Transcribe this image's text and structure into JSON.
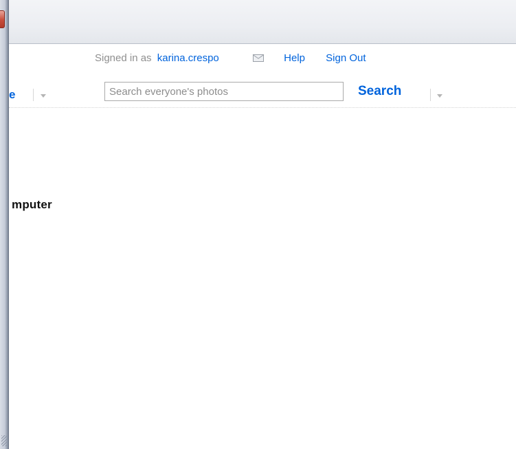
{
  "userbar": {
    "signed_in_label": "Signed in as",
    "username": "karina.crespo",
    "mail_icon": "mail-icon",
    "help_label": "Help",
    "sign_out_label": "Sign Out"
  },
  "nav": {
    "truncated_item_label": "e",
    "search_placeholder": "Search everyone's photos",
    "search_value": "",
    "search_button_label": "Search"
  },
  "content": {
    "heading_fragment": "mputer"
  },
  "colors": {
    "link": "#0063dc",
    "muted_text": "#8f8f8f",
    "heading": "#111111"
  }
}
